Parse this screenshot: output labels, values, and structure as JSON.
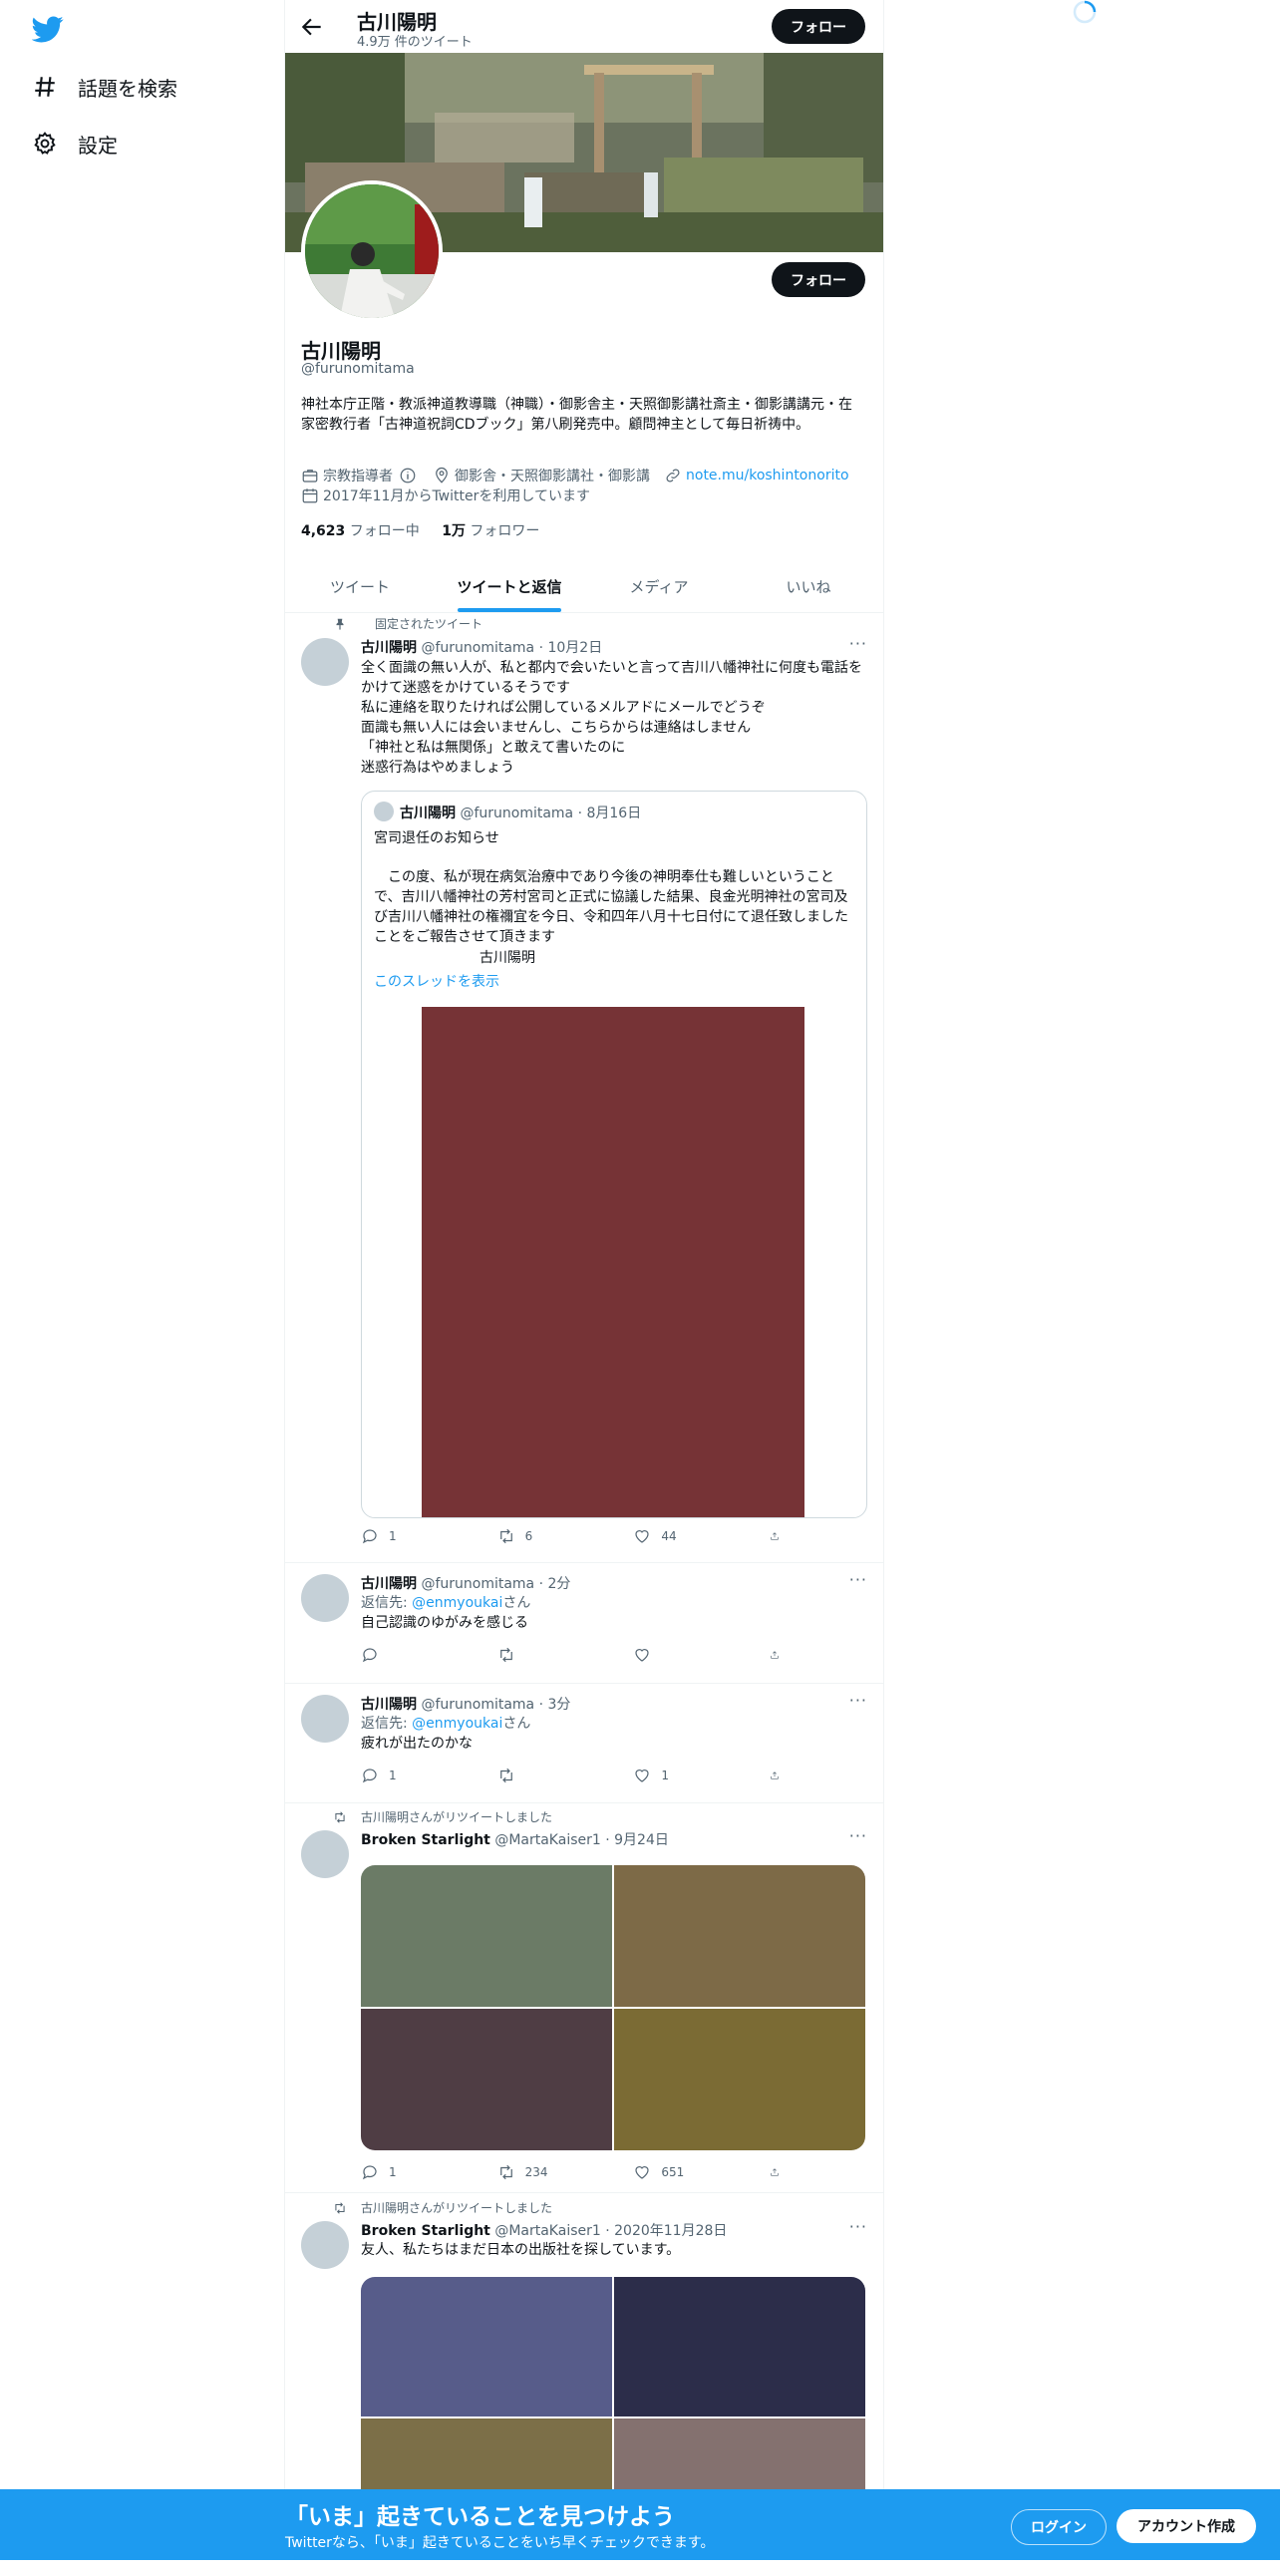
{
  "nav": {
    "items": [
      {
        "label": "話題を検索",
        "icon": "hashtag-icon"
      },
      {
        "label": "設定",
        "icon": "gear-icon"
      }
    ]
  },
  "header": {
    "title": "古川陽明",
    "subtitle": "4.9万 件のツイート",
    "follow_label": "フォロー"
  },
  "profile": {
    "name": "古川陽明",
    "handle": "@furunomitama",
    "follow_label": "フォロー",
    "bio": "神社本庁正階・教派神道教導職（神職）・御影舎主・天照御影講社斎主・御影講講元・在家密教行者「古神道祝詞CDブック」第八刷発売中。顧問神主として毎日祈祷中。",
    "category": "宗教指導者",
    "location": "御影舎・天照御影講社・御影講",
    "link": "note.mu/koshintonorito",
    "joined": "2017年11月からTwitterを利用しています",
    "following_count": "4,623",
    "following_label": "フォロー中",
    "followers_count": "1万",
    "followers_label": "フォロワー"
  },
  "tabs": [
    "ツイート",
    "ツイートと返信",
    "メディア",
    "いいね"
  ],
  "tweets": [
    {
      "context": "固定されたツイート",
      "name": "古川陽明",
      "handle": "@furunomitama · 10月2日",
      "text": "全く面識の無い人が、私と都内で会いたいと言って吉川八幡神社に何度も電話をかけて迷惑をかけているそうです\n私に連絡を取りたければ公開しているメルアドにメールでどうぞ\n面識も無い人には会いませんし、こちらからは連絡はしません\n「神社と私は無関係」と敢えて書いたのに\n迷惑行為はやめましょう",
      "quote": {
        "name": "古川陽明",
        "handle": "@furunomitama · 8月16日",
        "title": "宮司退任のお知らせ",
        "text": "　この度、私が現在病気治療中であり今後の神明奉仕も難しいということで、吉川八幡神社の芳村宮司と正式に協議した結果、良金光明神社の宮司及び吉川八幡神社の権禰宜を今日、令和四年八月十七日付にて退任致しましたことをご報告させて頂きます",
        "signature": "古川陽明",
        "thread_link": "このスレッドを表示"
      },
      "replies": "1",
      "retweets": "6",
      "likes": "44"
    },
    {
      "name": "古川陽明",
      "handle": "@furunomitama · 2分",
      "reply_prefix": "返信先: ",
      "reply_user": "@enmyoukai",
      "reply_suffix": "さん",
      "text": "自己認識のゆがみを感じる",
      "replies": "",
      "retweets": "",
      "likes": ""
    },
    {
      "name": "古川陽明",
      "handle": "@furunomitama · 3分",
      "reply_prefix": "返信先: ",
      "reply_user": "@enmyoukai",
      "reply_suffix": "さん",
      "text": "疲れが出たのかな",
      "replies": "1",
      "retweets": "",
      "likes": "1"
    },
    {
      "context": "古川陽明さんがリツイートしました",
      "name": "Broken Starlight",
      "handle": "@MartaKaiser1 · 9月24日",
      "text": "",
      "media_colors": [
        "#6b7b66",
        "#7d6a47",
        "#4f3d44",
        "#7b6b34"
      ],
      "replies": "1",
      "retweets": "234",
      "likes": "651"
    },
    {
      "context": "古川陽明さんがリツイートしました",
      "name": "Broken Starlight",
      "handle": "@MartaKaiser1 · 2020年11月28日",
      "text": "友人、私たちはまだ日本の出版社を探しています。",
      "media_colors": [
        "#575c8a",
        "#2c2d4a",
        "#7c6f48",
        "#84716f"
      ]
    }
  ],
  "bottom_bar": {
    "title": "「いま」起きていることを見つけよう",
    "subtitle": "Twitterなら、「いま」起きていることをいち早くチェックできます。",
    "login_label": "ログイン",
    "signup_label": "アカウント作成"
  },
  "colors": {
    "accent": "#1d9bf0",
    "text": "#0f1419",
    "muted": "#536471",
    "quote_image": "#763336"
  }
}
